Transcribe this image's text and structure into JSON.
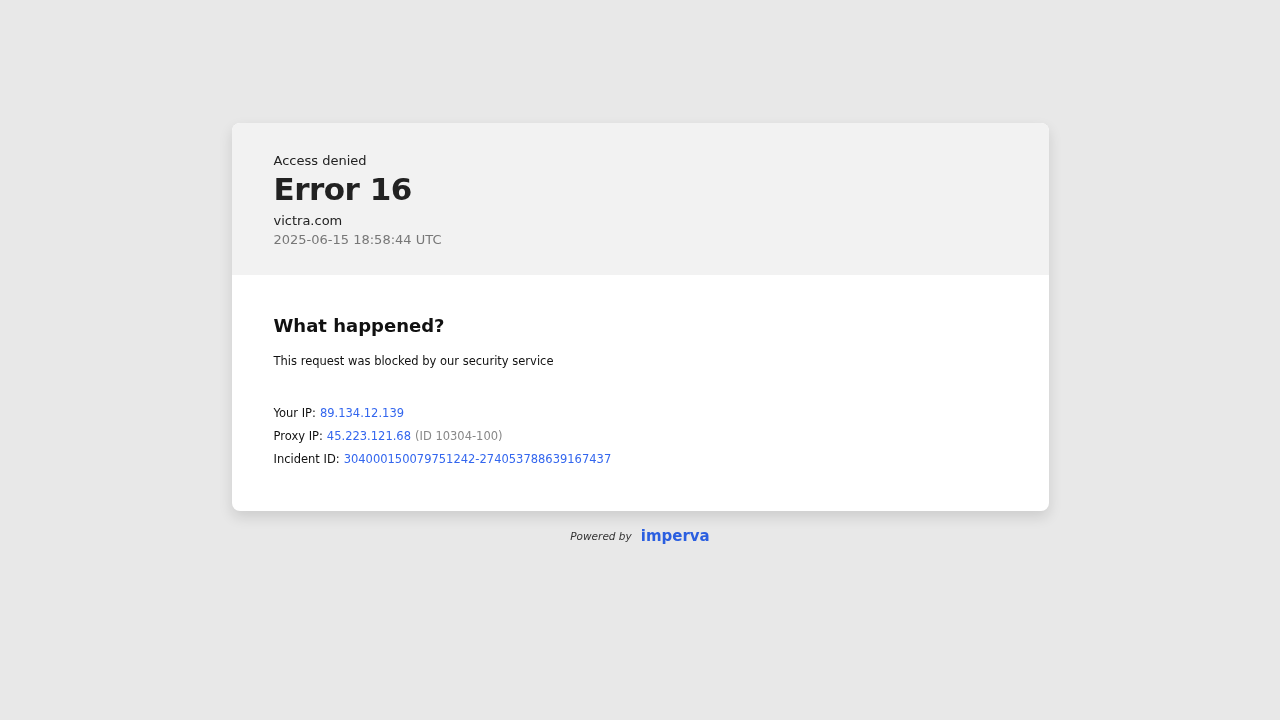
{
  "header": {
    "subtitle": "Access denied",
    "title": "Error 16",
    "domain": "victra.com",
    "timestamp": "2025-06-15 18:58:44 UTC"
  },
  "body": {
    "heading": "What happened?",
    "message": "This request was blocked by our security service",
    "details": [
      {
        "label": "Your IP:",
        "value": "89.134.12.139"
      },
      {
        "label": "Proxy IP:",
        "value": "45.223.121.68",
        "note": "(ID 10304-100)"
      },
      {
        "label": "Incident ID:",
        "value": "304000150079751242-274053788639167437"
      }
    ]
  },
  "footer": {
    "powered_by": "Powered by",
    "logo": "imperva"
  }
}
